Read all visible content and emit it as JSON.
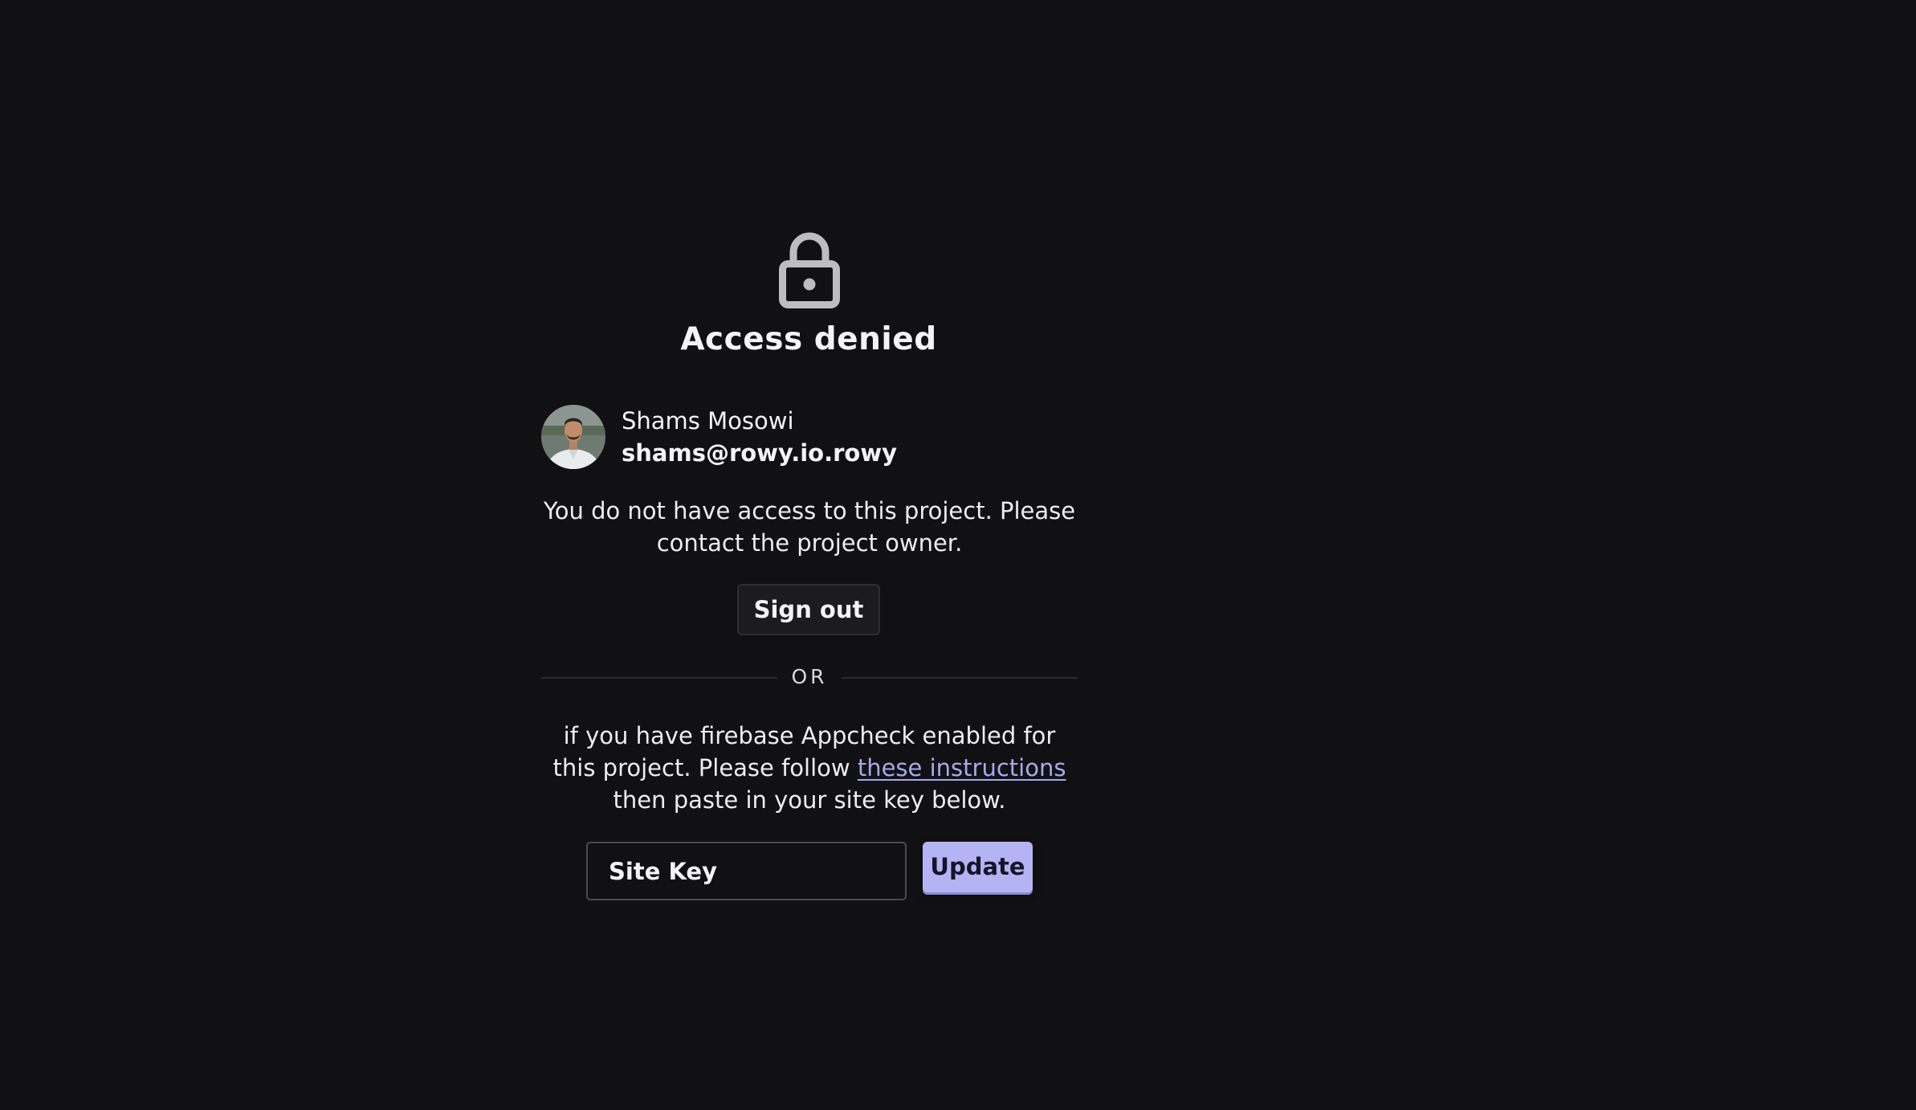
{
  "page": {
    "title": "Access denied",
    "icon": "lock-icon"
  },
  "user": {
    "name": "Shams Mosowi",
    "email": "shams@rowy.io.rowy",
    "avatar_icon": "user-avatar-photo"
  },
  "message": "You do not have access to this project. Please contact the project owner.",
  "sign_out_label": "Sign out",
  "divider_label": "OR",
  "appcheck": {
    "text_before": "if you have firebase Appcheck enabled for this project. Please follow ",
    "link_text": "these instructions",
    "text_after": " then paste in your site key below."
  },
  "site_key": {
    "placeholder": "Site Key",
    "value": ""
  },
  "update_label": "Update",
  "colors": {
    "background": "#111113",
    "accent": "#b4b4f4",
    "link": "#a8a8ee"
  }
}
